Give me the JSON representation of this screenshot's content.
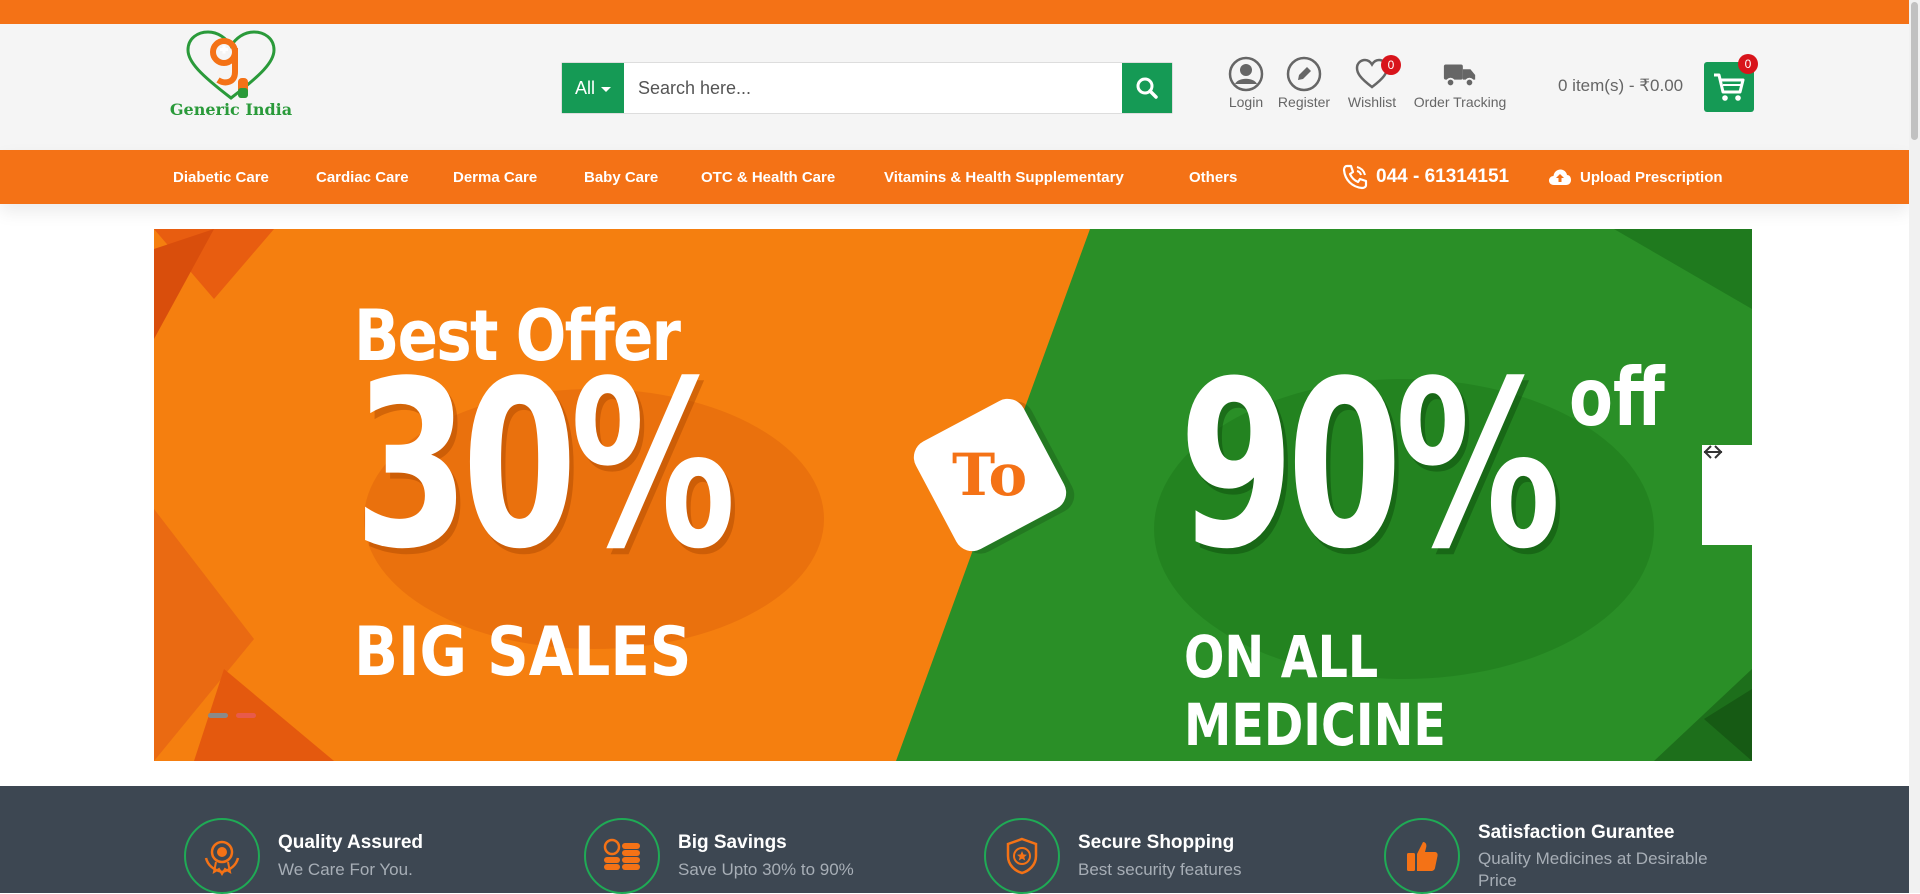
{
  "logo": {
    "text": "Generic India"
  },
  "search": {
    "category": "All",
    "placeholder": "Search here..."
  },
  "header_links": [
    {
      "label": "Login",
      "icon": "user-icon"
    },
    {
      "label": "Register",
      "icon": "edit-icon"
    },
    {
      "label": "Wishlist",
      "icon": "heart-icon",
      "badge": "0"
    },
    {
      "label": "Order Tracking",
      "icon": "truck-icon"
    }
  ],
  "cart": {
    "summary": "0 item(s) - ₹0.00",
    "badge": "0"
  },
  "nav": {
    "items": [
      "Diabetic Care",
      "Cardiac Care",
      "Derma Care",
      "Baby Care",
      "OTC & Health Care",
      "Vitamins & Health Supplementary",
      "Others"
    ],
    "phone": "044 - 61314151",
    "upload": "Upload Prescription"
  },
  "banner": {
    "left_top": "Best Offer",
    "left_big": "30%",
    "left_bottom": "BIG SALES",
    "middle": "To",
    "right_big": "90%",
    "right_off": "off",
    "right_bottom": "ON ALL MEDICINE"
  },
  "features": [
    {
      "title": "Quality Assured",
      "subtitle": "We Care For You.",
      "icon": "award-icon"
    },
    {
      "title": "Big Savings",
      "subtitle": "Save Upto 30% to 90%",
      "icon": "coins-icon"
    },
    {
      "title": "Secure Shopping",
      "subtitle": "Best security features",
      "icon": "shield-icon"
    },
    {
      "title": "Satisfaction Gurantee",
      "subtitle": "Quality Medicines at Desirable Price",
      "icon": "thumbs-up-icon"
    }
  ],
  "colors": {
    "brand_orange": "#f47216",
    "brand_green": "#159a55",
    "badge_red": "#d8141b",
    "footer_dark": "#3d4752"
  }
}
